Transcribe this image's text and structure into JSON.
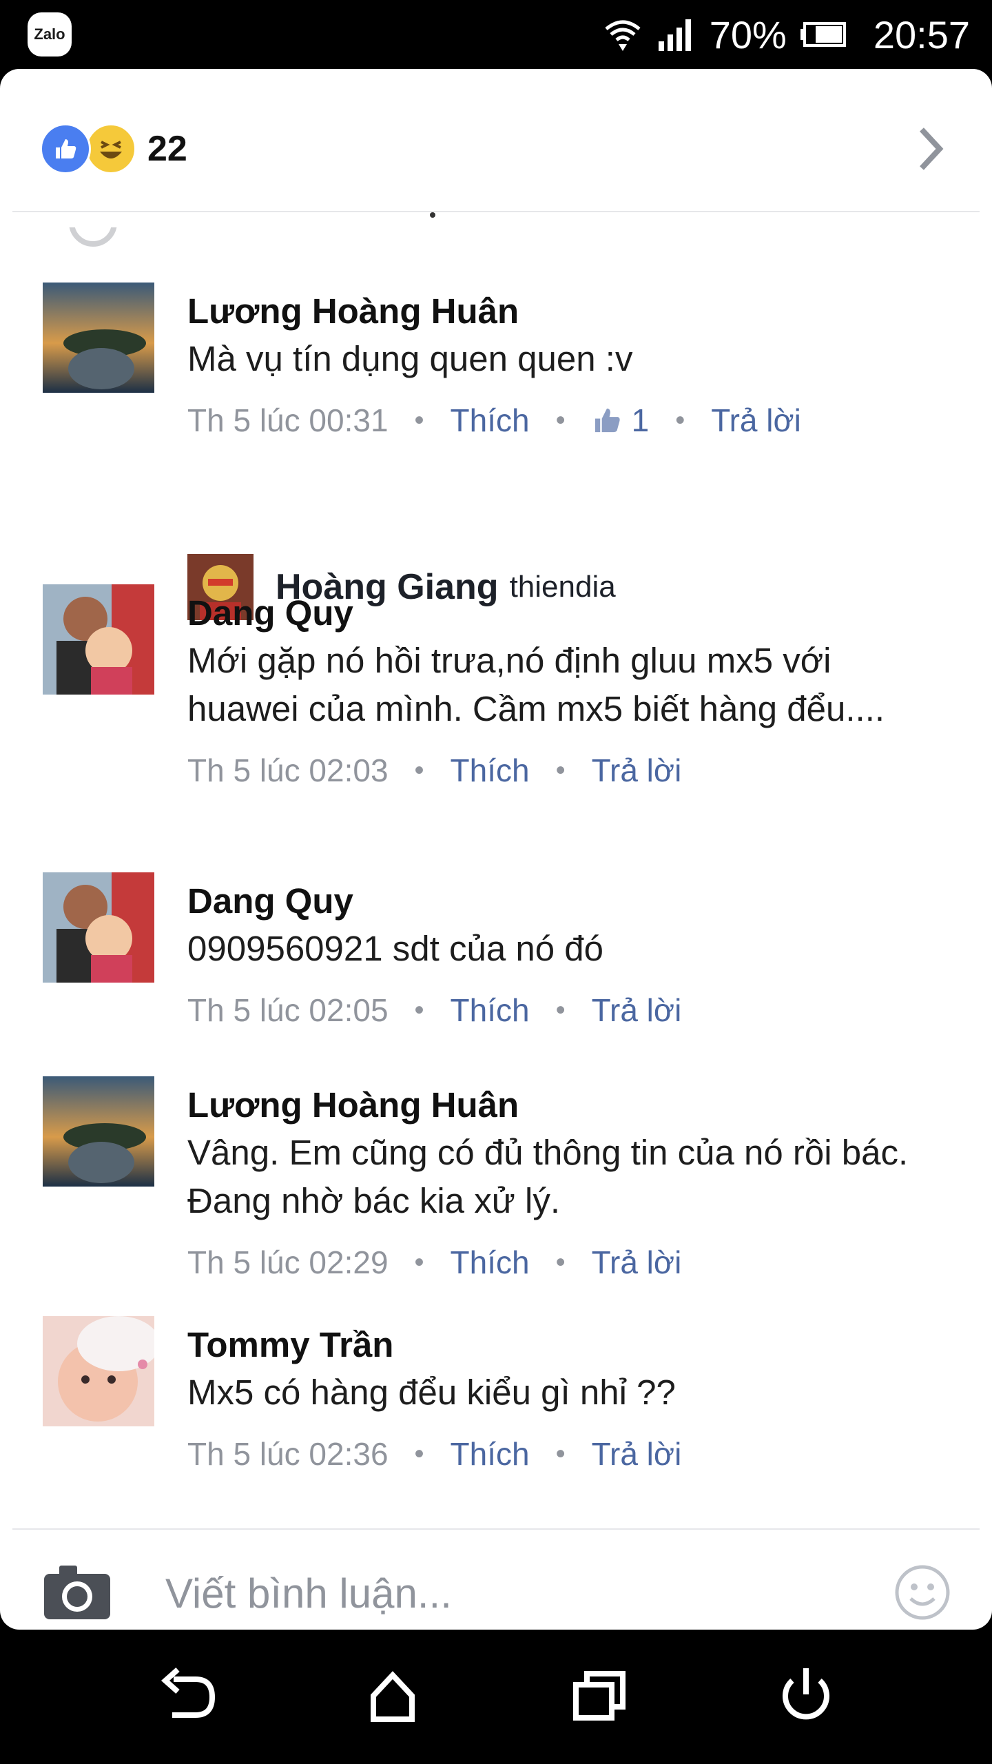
{
  "status_bar": {
    "app_badge": "Zalo",
    "battery": "70%",
    "time": "20:57"
  },
  "reactions": {
    "count": "22"
  },
  "comments": [
    {
      "name": "Lương Hoàng Huân",
      "text": "Mà vụ tín dụng quen quen :v",
      "time": "Th 5 lúc 00:31",
      "like": "Thích",
      "like_count": "1",
      "reply": "Trả lời"
    },
    {
      "name": "Dang Quy",
      "text": "Mới gặp nó hồi trưa,nó định gluu mx5 với huawei của mình. Cầm mx5 biết hàng đểu....",
      "time": "Th 5 lúc 02:03",
      "like": "Thích",
      "reply": "Trả lời"
    },
    {
      "name": "Dang Quy",
      "text": "0909560921 sdt của nó đó",
      "time": "Th 5 lúc 02:05",
      "like": "Thích",
      "reply": "Trả lời"
    },
    {
      "name": "Lương Hoàng Huân",
      "text": "Vâng. Em cũng có đủ thông tin của nó rồi bác. Đang nhờ bác kia xử lý.",
      "time": "Th 5 lúc 02:29",
      "like": "Thích",
      "reply": "Trả lời"
    },
    {
      "name": "Tommy Trần",
      "text": "Mx5 có hàng đểu kiểu gì nhỉ ??",
      "time": "Th 5 lúc 02:36",
      "like": "Thích",
      "reply": "Trả lời"
    }
  ],
  "reply_preview": {
    "name": "Hoàng Giang",
    "text": "thiendia"
  },
  "composer": {
    "placeholder": "Viết bình luận..."
  }
}
